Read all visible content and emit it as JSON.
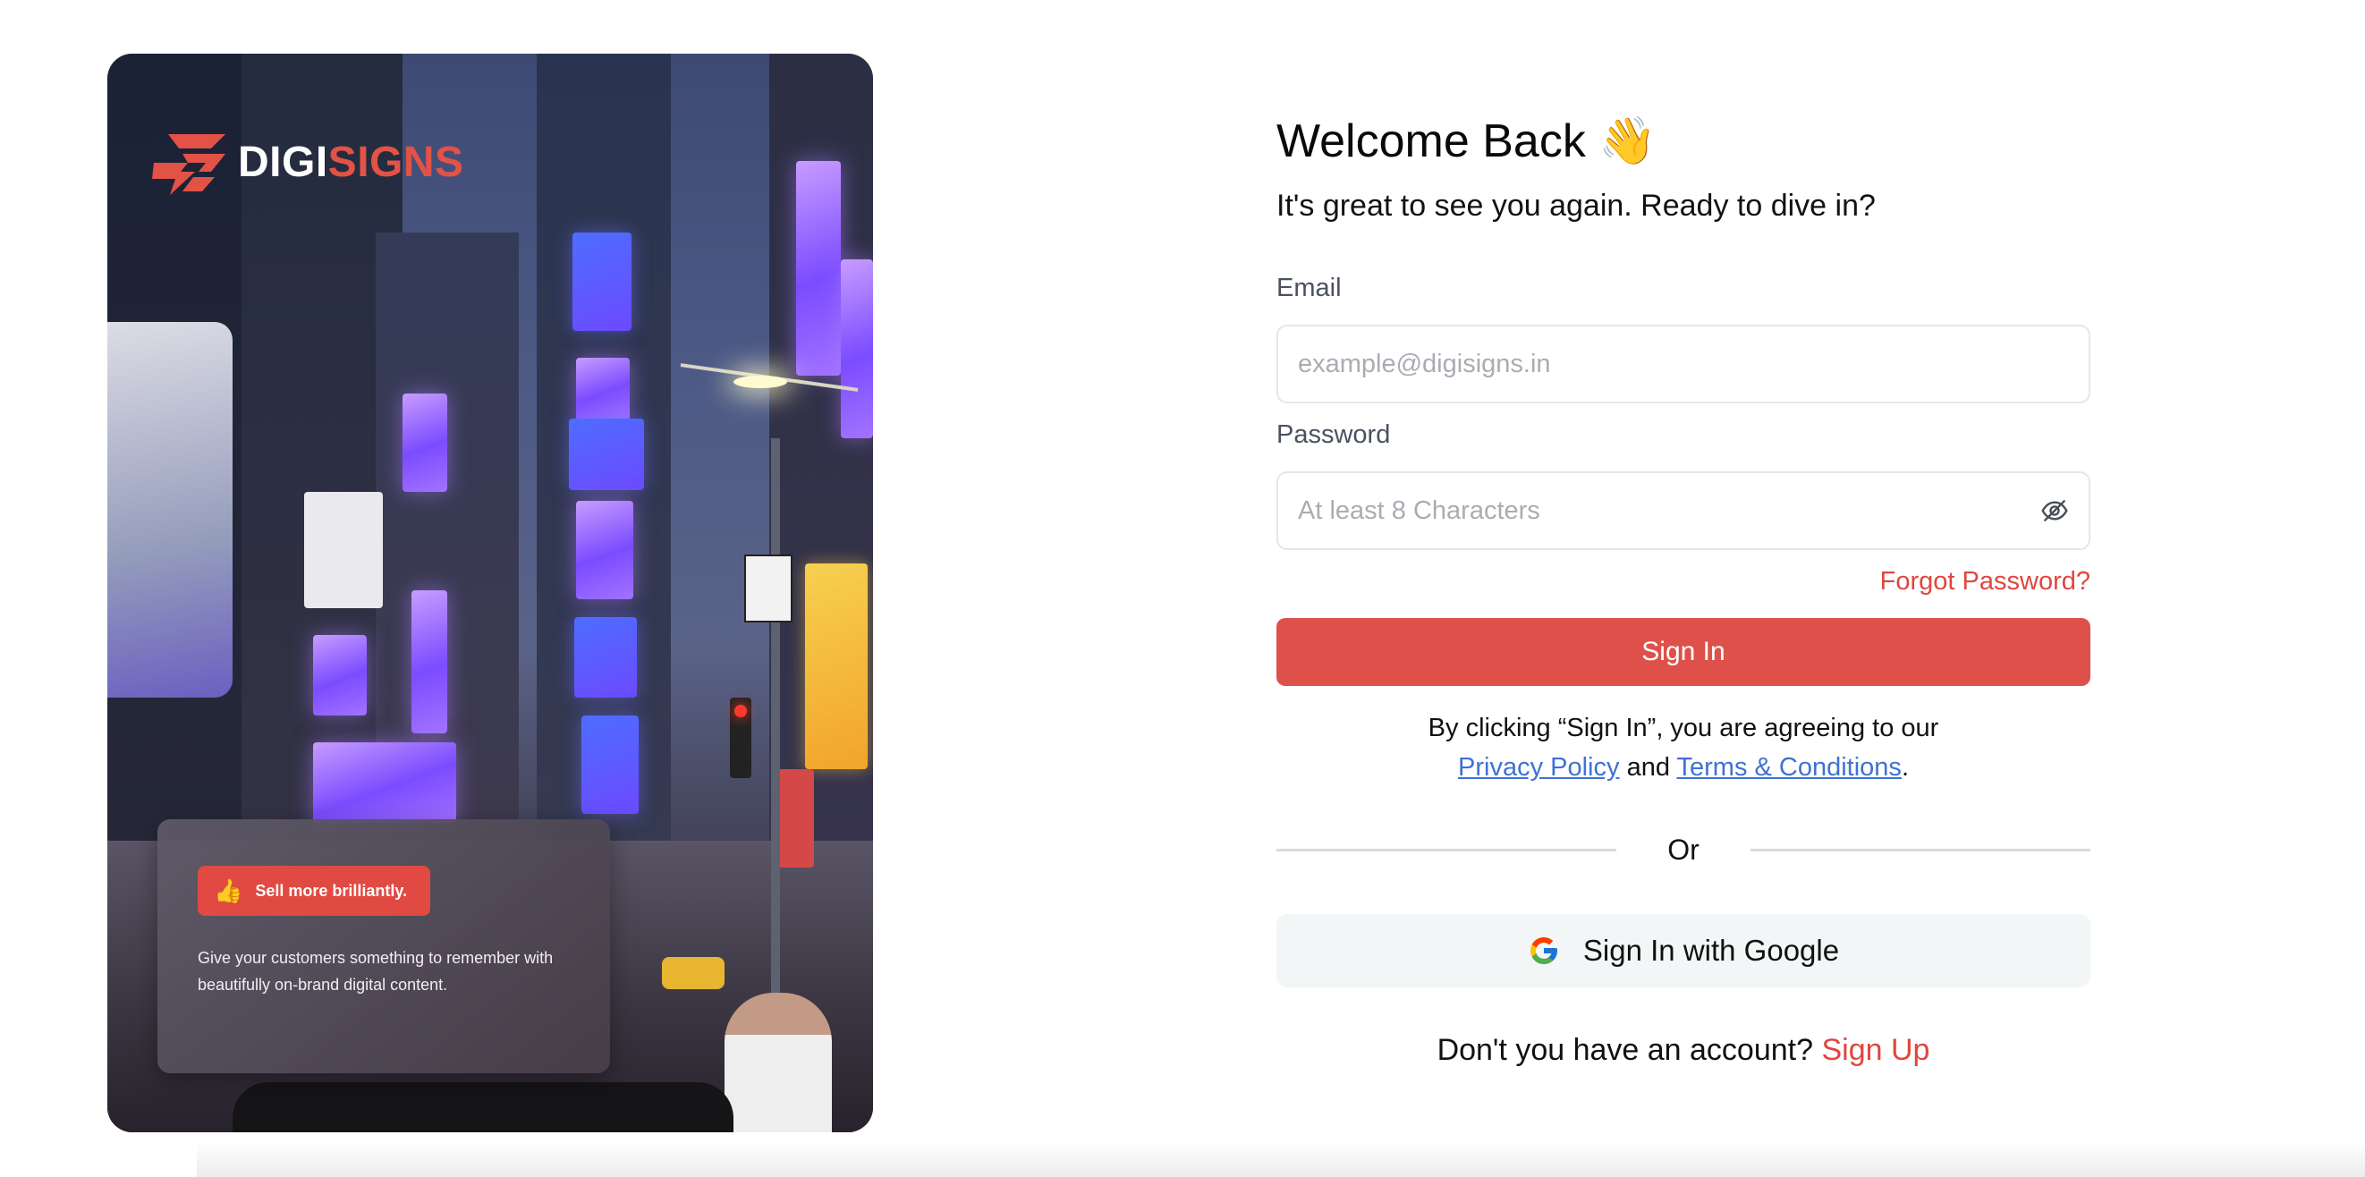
{
  "brand": {
    "name_primary": "DIGI",
    "name_accent": "SIGNS",
    "accent_color": "#dd514a"
  },
  "hero": {
    "badge_icon": "thumbs-up-icon",
    "badge_text": "Sell more brilliantly.",
    "description": "Give your customers something to remember with beautifully on-brand digital content."
  },
  "form": {
    "title": "Welcome Back 👋",
    "subtitle": "It's great to see you again. Ready to dive in?",
    "email_label": "Email",
    "email_placeholder": "example@digisigns.in",
    "email_value": "",
    "password_label": "Password",
    "password_placeholder": "At least 8 Characters",
    "password_value": "",
    "password_toggle_icon": "eye-off-icon",
    "forgot_password": "Forgot Password?",
    "signin_button": "Sign In",
    "agreement_prefix": "By clicking “Sign In”, you are agreeing to our",
    "privacy_policy": "Privacy Policy",
    "agreement_and": "and",
    "terms": "Terms & Conditions",
    "agreement_suffix": ".",
    "divider_text": "Or",
    "google_icon": "google-icon",
    "google_button": "Sign In with Google",
    "signup_prompt": "Don't you have an account?",
    "signup_link": "Sign Up"
  },
  "colors": {
    "primary_red": "#dd514a",
    "link_blue": "#3e72d4",
    "label_gray": "#4a5160",
    "google_btn_bg": "#f2f6f7"
  }
}
